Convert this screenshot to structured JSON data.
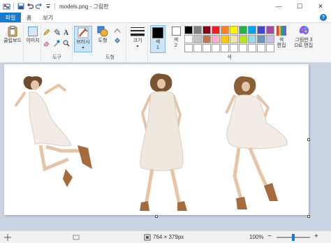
{
  "window": {
    "title": "models.png - 그림판",
    "minimize_glyph": "—",
    "maximize_glyph": "☐",
    "close_glyph": "✕"
  },
  "tabs": [
    {
      "label": "파일"
    },
    {
      "label": "홈"
    },
    {
      "label": "보기"
    }
  ],
  "help_glyph": "?",
  "ribbon": {
    "clipboard_label": "클립보드",
    "image_label": "이미지",
    "tools_group_label": "도구",
    "brushes_label": "브러시",
    "shapes_label": "도형",
    "shapes_group_label": "도형",
    "size_label": "크기",
    "color1_label": "색\n1",
    "color2_label": "색\n2",
    "colors_group_label": "색",
    "edit_colors_label": "색\n편집",
    "paint3d_label": "그림판 3\nD로 편집"
  },
  "palette_colors": [
    "#000000",
    "#7f7f7f",
    "#880015",
    "#ed1c24",
    "#ff7f27",
    "#fff200",
    "#22b14c",
    "#00a2e8",
    "#3f48cc",
    "#a349a4",
    "#ffffff",
    "#c3c3c3",
    "#b97a57",
    "#ffaec9",
    "#ffc90e",
    "#efe4b0",
    "#b5e61d",
    "#99d9ea",
    "#7092be",
    "#c8bfe7",
    "#ffffff",
    "#ffffff",
    "#ffffff",
    "#ffffff",
    "#ffffff",
    "#ffffff",
    "#ffffff",
    "#ffffff",
    "#ffffff",
    "#ffffff"
  ],
  "color1": "#000000",
  "color2": "#ffffff",
  "status": {
    "image_size": "764 × 379px",
    "zoom": "100%",
    "zoom_level": 1.0,
    "zoom_minus": "−",
    "zoom_plus": "+"
  }
}
